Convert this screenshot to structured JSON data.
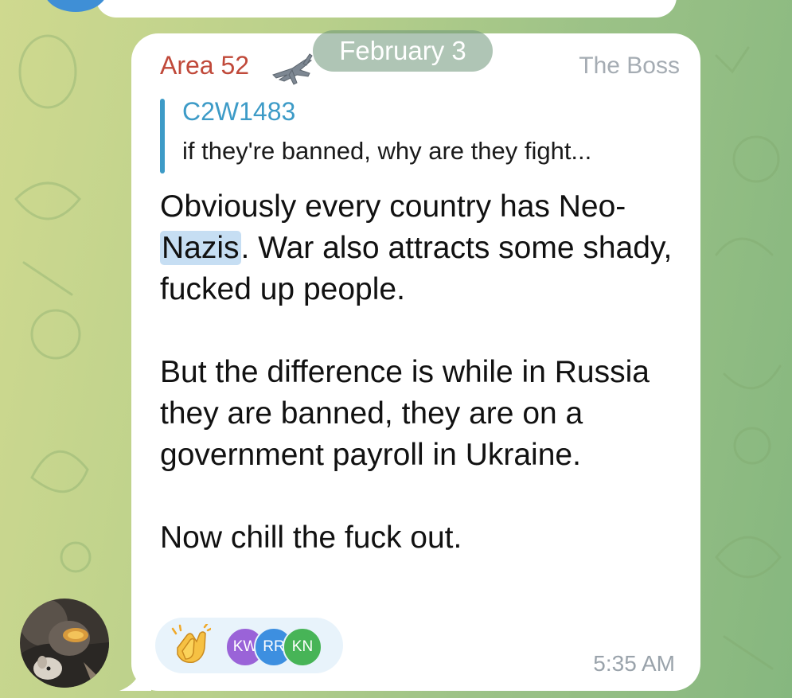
{
  "chat": {
    "date_separator": "February 3"
  },
  "message": {
    "sender_name": "Area 52",
    "sender_badge_icon": "fighter-jet-icon",
    "sender_role": "The Boss",
    "reply": {
      "author": "C2W1483",
      "snippet": "if they're banned, why are they fight..."
    },
    "text": {
      "p1_before": "Obviously every country has Neo-",
      "p1_highlight": "Nazis",
      "p1_after": ". War also attracts some shady, fucked up people.",
      "p2": "But the difference is while in Russia they are banned, they are on a government payroll in Ukraine.",
      "p3": "Now chill the fuck out."
    },
    "reactions": {
      "emoji_icon": "clapping-hands-icon",
      "reactors": [
        "KW",
        "RR",
        "KN"
      ]
    },
    "time": "5:35 AM"
  },
  "colors": {
    "sender_name": "#c0493a",
    "reply_accent": "#3d9bc7",
    "highlight": "#c6def3",
    "bubble": "#ffffff",
    "reactor_kw": "#9a63d8",
    "reactor_rr": "#3d8fe0",
    "reactor_kn": "#47b457"
  }
}
